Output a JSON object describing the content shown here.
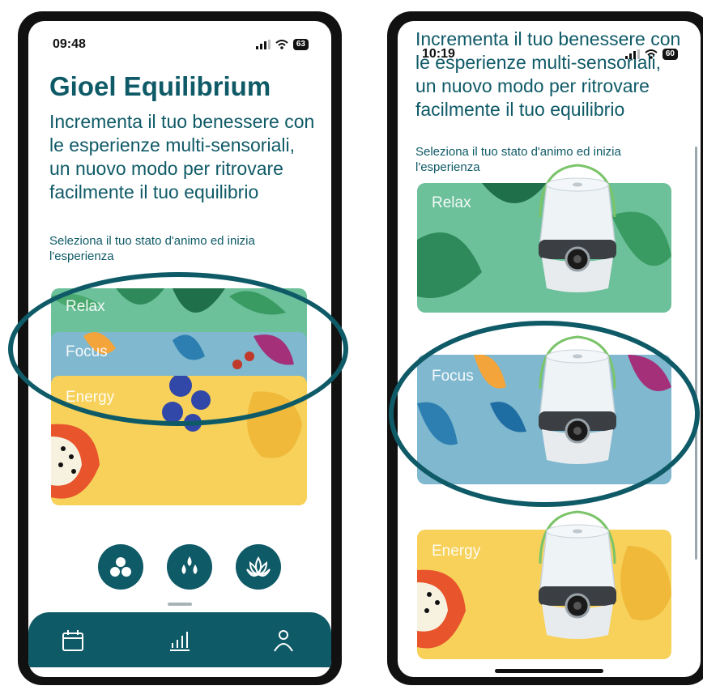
{
  "left_screen": {
    "status": {
      "time": "09:48",
      "battery": "63"
    },
    "title": "Gioel Equilibrium",
    "intro": "Incrementa il tuo benessere con le esperienze multi-sensoriali, un nuovo modo per ritrovare facilmente il tuo equilibrio",
    "prompt": "Seleziona il tuo stato d'animo ed inizia l'esperienza",
    "cards": [
      {
        "label": "Relax"
      },
      {
        "label": "Focus"
      },
      {
        "label": "Energy"
      }
    ],
    "actions": [
      "molecule-icon",
      "drops-icon",
      "lotus-icon"
    ],
    "tab_bar": [
      "calendar-icon",
      "stats-icon",
      "profile-icon"
    ]
  },
  "right_screen": {
    "status": {
      "time": "10:19",
      "battery": "60"
    },
    "intro": "Incrementa il tuo benessere con le esperienze multi-sensoriali, un nuovo modo per ritrovare facilmente il tuo equilibrio",
    "prompt": "Seleziona il tuo stato d'animo ed inizia l'esperienza",
    "cards": [
      {
        "label": "Relax"
      },
      {
        "label": "Focus"
      },
      {
        "label": "Energy"
      }
    ]
  },
  "colors": {
    "brand_teal": "#0f5a67",
    "relax_green": "#6cc19a",
    "focus_blue": "#7fb8cf",
    "energy_yellow": "#f7d15a"
  }
}
